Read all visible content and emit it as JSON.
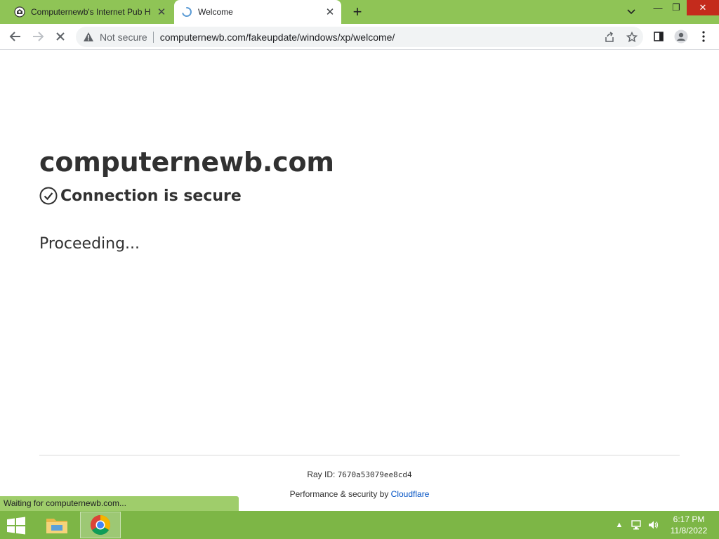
{
  "browser": {
    "tabs": [
      {
        "title": "Computernewb's Internet Pub H",
        "active": false
      },
      {
        "title": "Welcome",
        "active": true
      }
    ],
    "window_controls": {
      "minimize": "—",
      "maximize": "❐",
      "close": "✕"
    }
  },
  "toolbar": {
    "security_label": "Not secure",
    "url": "computernewb.com/fakeupdate/windows/xp/welcome/"
  },
  "page": {
    "site_title": "computernewb.com",
    "secure_text": "Connection is secure",
    "proceeding_text": "Proceeding...",
    "ray_label": "Ray ID:",
    "ray_id": "7670a53079ee8cd4",
    "perf_text": "Performance & security by",
    "perf_link": "Cloudflare"
  },
  "status_bar": {
    "text": "Waiting for computernewb.com..."
  },
  "taskbar": {
    "time": "6:17 PM",
    "date": "11/8/2022"
  },
  "colors": {
    "tabstrip": "#8fc456",
    "taskbar": "#7db646",
    "status_bubble": "#9fcd6b",
    "link": "#0051c3"
  }
}
